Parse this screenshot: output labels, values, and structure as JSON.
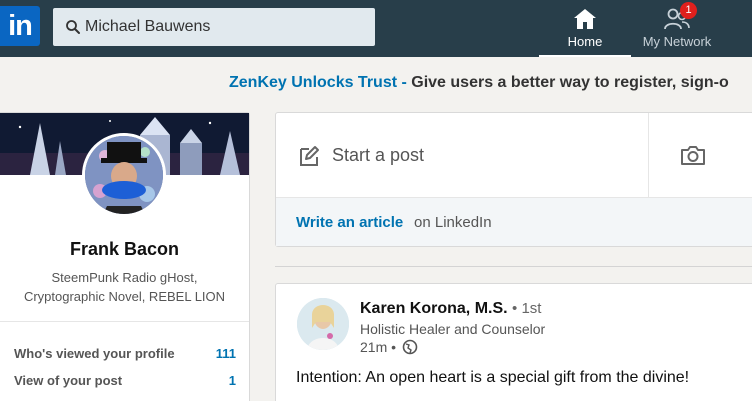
{
  "nav": {
    "logo_text": "in",
    "search_value": "Michael Bauwens",
    "items": [
      {
        "label": "Home",
        "icon": "home-icon",
        "active": true
      },
      {
        "label": "My Network",
        "icon": "network-icon",
        "badge": "1"
      }
    ]
  },
  "ad": {
    "brand": "ZenKey Unlocks Trust",
    "separator": " - ",
    "message": "Give users a better way to register, sign-o"
  },
  "profile": {
    "name": "Frank Bacon",
    "headline": "SteemPunk Radio gHost, Cryptographic Novel, REBEL LION",
    "stats": [
      {
        "label": "Who's viewed your profile",
        "value": "111"
      },
      {
        "label": "View of your post",
        "value": "1"
      }
    ]
  },
  "share": {
    "start_label": "Start a post",
    "write_article": "Write an article",
    "on_linkedin": "on LinkedIn",
    "icons": [
      "pencil-icon",
      "camera-icon"
    ]
  },
  "post": {
    "author": "Karen Korona, M.S.",
    "degree": "• 1st",
    "headline": "Holistic Healer and Counselor",
    "time": "21m •",
    "text": "Intention: An open heart is a special gift from the divine!"
  },
  "colors": {
    "nav_bg": "#283e4a",
    "accent": "#0073b1",
    "badge": "#e0201d",
    "page_bg": "#f3f2ef"
  }
}
